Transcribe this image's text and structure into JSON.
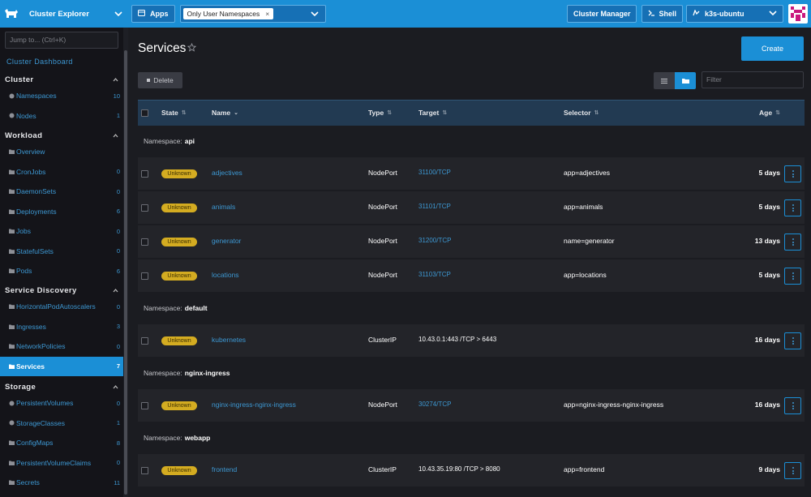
{
  "topbar": {
    "app_title": "Cluster Explorer",
    "apps_label": "Apps",
    "namespace_filter": "Only User Namespaces",
    "cluster_manager_label": "Cluster Manager",
    "shell_label": "Shell",
    "cluster_name": "k3s-ubuntu",
    "accent_color": "#1b8fd6"
  },
  "sidebar": {
    "jump_placeholder": "Jump to... (Ctrl+K)",
    "dashboard_link": "Cluster Dashboard",
    "groups": [
      {
        "label": "Cluster",
        "items": [
          {
            "label": "Namespaces",
            "count": "10",
            "icon": "circle-icon"
          },
          {
            "label": "Nodes",
            "count": "1",
            "icon": "circle-icon"
          }
        ]
      },
      {
        "label": "Workload",
        "items": [
          {
            "label": "Overview",
            "count": "",
            "icon": "folder-icon"
          },
          {
            "label": "CronJobs",
            "count": "0",
            "icon": "folder-icon"
          },
          {
            "label": "DaemonSets",
            "count": "0",
            "icon": "folder-icon"
          },
          {
            "label": "Deployments",
            "count": "6",
            "icon": "folder-icon"
          },
          {
            "label": "Jobs",
            "count": "0",
            "icon": "folder-icon"
          },
          {
            "label": "StatefulSets",
            "count": "0",
            "icon": "folder-icon"
          },
          {
            "label": "Pods",
            "count": "6",
            "icon": "folder-icon"
          }
        ]
      },
      {
        "label": "Service Discovery",
        "items": [
          {
            "label": "HorizontalPodAutoscalers",
            "count": "0",
            "icon": "folder-icon"
          },
          {
            "label": "Ingresses",
            "count": "3",
            "icon": "folder-icon"
          },
          {
            "label": "NetworkPolicies",
            "count": "0",
            "icon": "folder-icon"
          },
          {
            "label": "Services",
            "count": "7",
            "icon": "folder-icon",
            "active": true
          }
        ]
      },
      {
        "label": "Storage",
        "items": [
          {
            "label": "PersistentVolumes",
            "count": "0",
            "icon": "circle-icon"
          },
          {
            "label": "StorageClasses",
            "count": "1",
            "icon": "circle-icon"
          },
          {
            "label": "ConfigMaps",
            "count": "8",
            "icon": "folder-icon"
          },
          {
            "label": "PersistentVolumeClaims",
            "count": "0",
            "icon": "folder-icon"
          },
          {
            "label": "Secrets",
            "count": "11",
            "icon": "folder-icon"
          }
        ]
      }
    ]
  },
  "main": {
    "title": "Services",
    "create_label": "Create",
    "delete_label": "Delete",
    "filter_placeholder": "Filter",
    "columns": {
      "state": "State",
      "name": "Name",
      "type": "Type",
      "target": "Target",
      "selector": "Selector",
      "age": "Age"
    },
    "namespace_prefix": "Namespace:",
    "groups": [
      {
        "namespace": "api",
        "rows": [
          {
            "state": "Unknown",
            "name": "adjectives",
            "type": "NodePort",
            "target": "31100/TCP",
            "target_link": true,
            "selector": "app=adjectives",
            "age": "5 days"
          },
          {
            "state": "Unknown",
            "name": "animals",
            "type": "NodePort",
            "target": "31101/TCP",
            "target_link": true,
            "selector": "app=animals",
            "age": "5 days"
          },
          {
            "state": "Unknown",
            "name": "generator",
            "type": "NodePort",
            "target": "31200/TCP",
            "target_link": true,
            "selector": "name=generator",
            "age": "13 days"
          },
          {
            "state": "Unknown",
            "name": "locations",
            "type": "NodePort",
            "target": "31103/TCP",
            "target_link": true,
            "selector": "app=locations",
            "age": "5 days"
          }
        ]
      },
      {
        "namespace": "default",
        "rows": [
          {
            "state": "Unknown",
            "name": "kubernetes",
            "type": "ClusterIP",
            "target": "10.43.0.1:443 /TCP > 6443",
            "target_link": false,
            "selector": "",
            "age": "16 days"
          }
        ]
      },
      {
        "namespace": "nginx-ingress",
        "rows": [
          {
            "state": "Unknown",
            "name": "nginx-ingress-nginx-ingress",
            "type": "NodePort",
            "target": "30274/TCP",
            "target_link": true,
            "selector": "app=nginx-ingress-nginx-ingress",
            "age": "16 days"
          }
        ]
      },
      {
        "namespace": "webapp",
        "rows": [
          {
            "state": "Unknown",
            "name": "frontend",
            "type": "ClusterIP",
            "target": "10.43.35.19:80 /TCP > 8080",
            "target_link": false,
            "selector": "app=frontend",
            "age": "9 days"
          }
        ]
      }
    ]
  }
}
